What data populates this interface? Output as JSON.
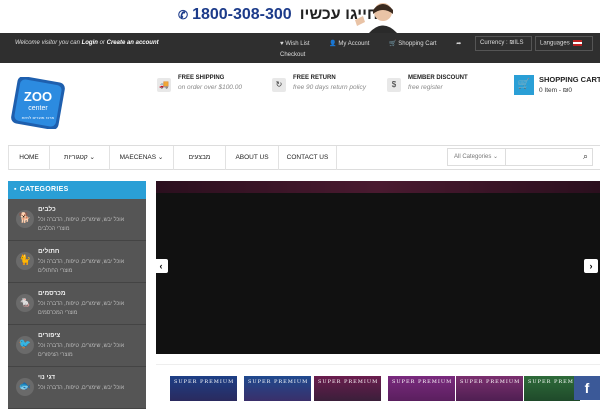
{
  "banner": {
    "phone_number": "1800-308-300",
    "phone_text": "חייגו עכשיו"
  },
  "topbar": {
    "welcome_prefix": "Welcome visitor you can",
    "login": "Login",
    "or": "or",
    "create_account": "Create an account",
    "links": [
      "Wish List",
      "My Account",
      "Shopping Cart",
      "Checkout"
    ],
    "currency_label": "Currency : ₪ILS",
    "language_label": "Languages"
  },
  "header": {
    "logo_text": "ZOO center",
    "logo_tagline": "מרכז מוצרים לחיות",
    "features": [
      {
        "icon": "truck-icon",
        "title": "FREE SHIPPING",
        "subtitle": "on order over $100.00"
      },
      {
        "icon": "return-icon",
        "title": "FREE RETURN",
        "subtitle": "free 90 days return policy"
      },
      {
        "icon": "money-icon",
        "title": "MEMBER DISCOUNT",
        "subtitle": "free register"
      }
    ],
    "cart_title": "SHOPPING CART",
    "cart_value": "0 Item - ₪0"
  },
  "nav": {
    "items": [
      "HOME",
      "קטגוריות",
      "MAECENAS",
      "מבצעים",
      "ABOUT US",
      "CONTACT US"
    ],
    "search_category": "All Categories",
    "search_placeholder": ""
  },
  "sidebar": {
    "title": "CATEGORIES",
    "categories": [
      {
        "name": "כלבים",
        "desc": "אוכל יבש, שימורים, טיפוח, הדברה וכל מוצרי הכלבים",
        "icon": "dog-icon"
      },
      {
        "name": "חתולים",
        "desc": "אוכל יבש, שימורים, טיפוח, הדברה וכל מוצרי החתולים",
        "icon": "cat-icon"
      },
      {
        "name": "מכרסמים",
        "desc": "אוכל יבש, שימורים, טיפוח, הדברה וכל מוצרי המכרסמים",
        "icon": "rodent-icon"
      },
      {
        "name": "ציפורים",
        "desc": "אוכל יבש, שימורים, טיפוח, הדברה וכל מוצרי הציפורים",
        "icon": "bird-icon"
      },
      {
        "name": "דגי נוי",
        "desc": "אוכל יבש, שימורים, טיפוח, הדברה וכל",
        "icon": "fish-icon"
      }
    ]
  },
  "products": {
    "labels": [
      "SUPER PREMIUM",
      "SUPER PREMIUM",
      "SUPER PREMIUM",
      "SUPER PREMIUM",
      "SUPER PREMIUM",
      "SUPER PREMIUM"
    ]
  },
  "colors": {
    "accent": "#2a9fd6",
    "topbar": "#2f2f2f",
    "sidebar": "#555555",
    "facebook": "#3b5998"
  }
}
